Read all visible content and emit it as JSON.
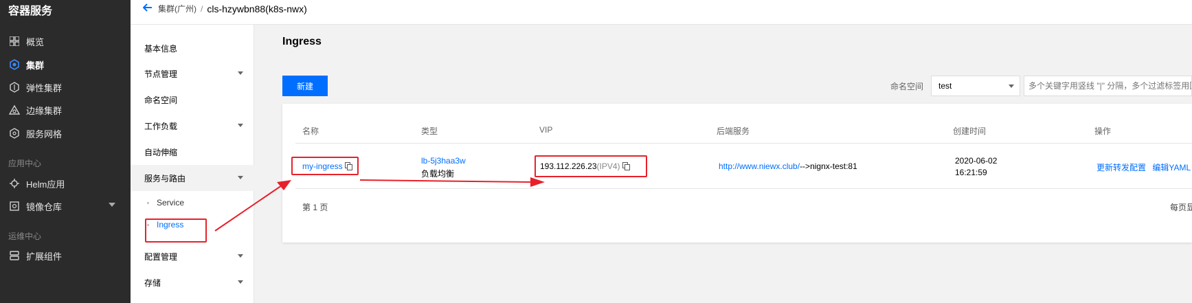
{
  "nav": {
    "title": "容器服务",
    "items": [
      {
        "label": "概览",
        "icon": "grid-icon"
      },
      {
        "label": "集群",
        "icon": "cluster-icon"
      },
      {
        "label": "弹性集群",
        "icon": "elastic-cluster-icon"
      },
      {
        "label": "边缘集群",
        "icon": "edge-cluster-icon"
      },
      {
        "label": "服务网格",
        "icon": "service-mesh-icon"
      }
    ],
    "section_apps": "应用中心",
    "app_items": [
      {
        "label": "Helm应用",
        "icon": "helm-icon"
      },
      {
        "label": "镜像仓库",
        "icon": "registry-icon"
      }
    ],
    "section_ops": "运维中心",
    "ops_items": [
      {
        "label": "扩展组件",
        "icon": "extension-icon"
      }
    ]
  },
  "breadcrumb": {
    "parent": "集群(广州)",
    "separator": "/",
    "current": "cls-hzywbn88(k8s-nwx)"
  },
  "submenu": {
    "items": [
      "基本信息",
      "节点管理",
      "命名空间",
      "工作负载",
      "自动伸缩",
      "服务与路由",
      "配置管理",
      "存储"
    ],
    "children": [
      "Service",
      "Ingress"
    ]
  },
  "main": {
    "title": "Ingress",
    "new_button": "新建",
    "namespace_label": "命名空间",
    "namespace_value": "test",
    "search_placeholder": "多个关键字用竖线 \"|\" 分隔，多个过滤标签用回",
    "columns": [
      "名称",
      "类型",
      "VIP",
      "后端服务",
      "创建时间",
      "操作"
    ],
    "row": {
      "name": "my-ingress",
      "type_id": "lb-5j3haa3w",
      "type_desc": "负载均衡",
      "vip": "193.112.226.23",
      "vip_tag": "(IPV4)",
      "backend": "http://www.niewx.club/",
      "backend_target": "-->nignx-test:81",
      "created_date": "2020-06-02",
      "created_time": "16:21:59",
      "action_update": "更新转发配置",
      "action_edit": "编辑YAML"
    },
    "pager_left": "第 1 页",
    "pager_right": "每页显"
  },
  "colors": {
    "accent": "#006eff",
    "sidebar_bg": "#2b2b2b",
    "annotation": "#e8202a"
  }
}
